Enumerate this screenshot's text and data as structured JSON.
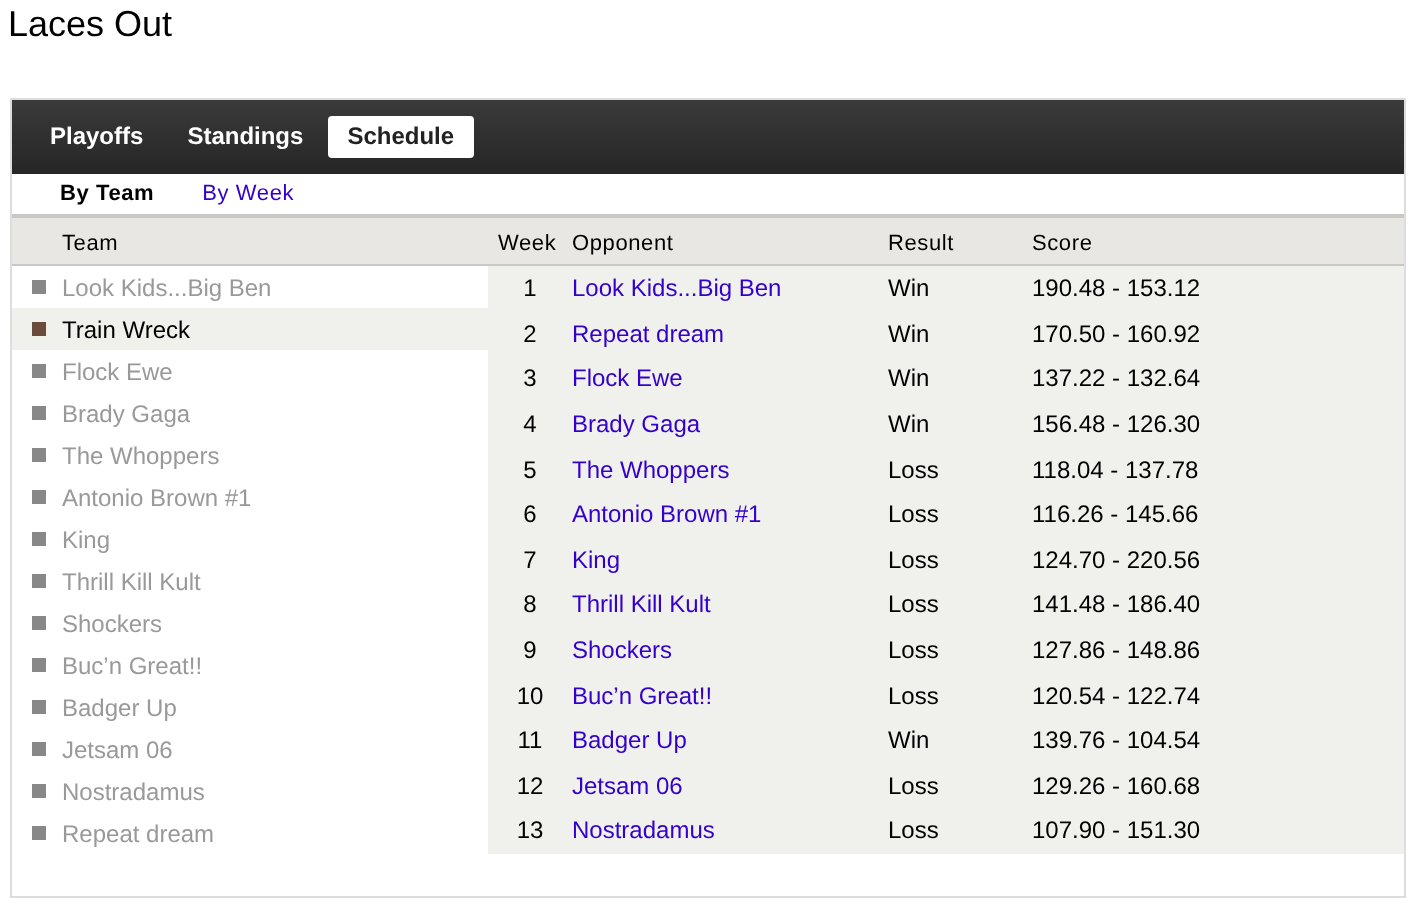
{
  "title": "Laces Out",
  "tabs": [
    {
      "label": "Playoffs",
      "selected": false
    },
    {
      "label": "Standings",
      "selected": false
    },
    {
      "label": "Schedule",
      "selected": true
    }
  ],
  "subtabs": [
    {
      "label": "By Team",
      "selected": true
    },
    {
      "label": "By Week",
      "selected": false
    }
  ],
  "teams": {
    "heading": "Team",
    "items": [
      {
        "name": "Look Kids...Big Ben",
        "selected": false
      },
      {
        "name": "Train Wreck",
        "selected": true
      },
      {
        "name": "Flock Ewe",
        "selected": false
      },
      {
        "name": "Brady Gaga",
        "selected": false
      },
      {
        "name": "The Whoppers",
        "selected": false
      },
      {
        "name": "Antonio Brown #1",
        "selected": false
      },
      {
        "name": "King",
        "selected": false
      },
      {
        "name": "Thrill Kill Kult",
        "selected": false
      },
      {
        "name": "Shockers",
        "selected": false
      },
      {
        "name": "Buc’n Great!!",
        "selected": false
      },
      {
        "name": "Badger Up",
        "selected": false
      },
      {
        "name": "Jetsam 06",
        "selected": false
      },
      {
        "name": "Nostradamus",
        "selected": false
      },
      {
        "name": "Repeat dream",
        "selected": false
      }
    ]
  },
  "schedule": {
    "columns": [
      "Week",
      "Opponent",
      "Result",
      "Score"
    ],
    "rows": [
      [
        "1",
        "Look Kids...Big Ben",
        "Win",
        "190.48 - 153.12"
      ],
      [
        "2",
        "Repeat dream",
        "Win",
        "170.50 - 160.92"
      ],
      [
        "3",
        "Flock Ewe",
        "Win",
        "137.22 - 132.64"
      ],
      [
        "4",
        "Brady Gaga",
        "Win",
        "156.48 - 126.30"
      ],
      [
        "5",
        "The Whoppers",
        "Loss",
        "118.04 - 137.78"
      ],
      [
        "6",
        "Antonio Brown #1",
        "Loss",
        "116.26 - 145.66"
      ],
      [
        "7",
        "King",
        "Loss",
        "124.70 - 220.56"
      ],
      [
        "8",
        "Thrill Kill Kult",
        "Loss",
        "141.48 - 186.40"
      ],
      [
        "9",
        "Shockers",
        "Loss",
        "127.86 - 148.86"
      ],
      [
        "10",
        "Buc’n Great!!",
        "Loss",
        "120.54 - 122.74"
      ],
      [
        "11",
        "Badger Up",
        "Win",
        "139.76 - 104.54"
      ],
      [
        "12",
        "Jetsam 06",
        "Loss",
        "129.26 - 160.68"
      ],
      [
        "13",
        "Nostradamus",
        "Loss",
        "107.90 - 151.30"
      ]
    ]
  }
}
